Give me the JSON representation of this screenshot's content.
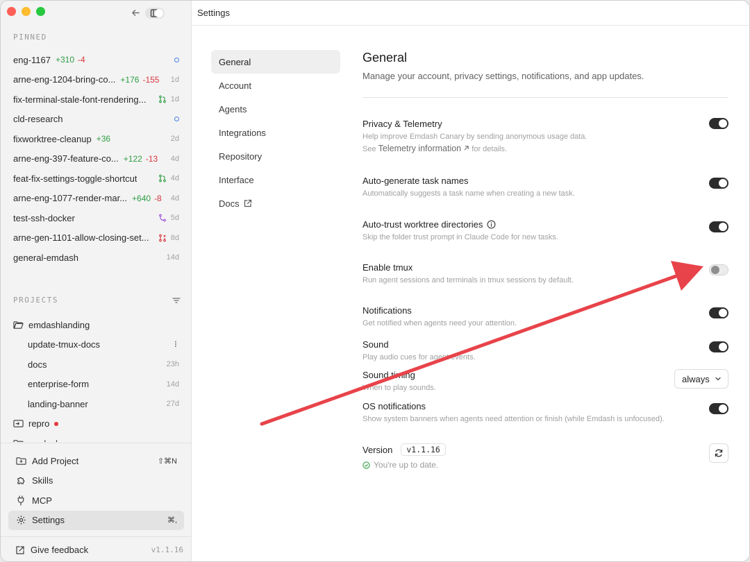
{
  "window": {
    "title": "Settings"
  },
  "sidebar": {
    "pinned_label": "PINNED",
    "pinned": [
      {
        "name": "eng-1167",
        "add": "+310",
        "del": "-4",
        "indicator": "dot",
        "age": ""
      },
      {
        "name": "arne-eng-1204-bring-co...",
        "add": "+176",
        "del": "-155",
        "indicator": "",
        "age": "1d"
      },
      {
        "name": "fix-terminal-stale-font-rendering...",
        "add": "",
        "del": "",
        "indicator": "pr-green",
        "age": "1d"
      },
      {
        "name": "cld-research",
        "add": "",
        "del": "",
        "indicator": "dot",
        "age": ""
      },
      {
        "name": "fixworktree-cleanup",
        "add": "+36",
        "del": "",
        "indicator": "",
        "age": "2d"
      },
      {
        "name": "arne-eng-397-feature-co...",
        "add": "+122",
        "del": "-13",
        "indicator": "",
        "age": "4d"
      },
      {
        "name": "feat-fix-settings-toggle-shortcut",
        "add": "",
        "del": "",
        "indicator": "pr-green",
        "age": "4d"
      },
      {
        "name": "arne-eng-1077-render-mar...",
        "add": "+640",
        "del": "-8",
        "indicator": "",
        "age": "4d"
      },
      {
        "name": "test-ssh-docker",
        "add": "",
        "del": "",
        "indicator": "branch-purple",
        "age": "5d"
      },
      {
        "name": "arne-gen-1101-allow-closing-set...",
        "add": "",
        "del": "",
        "indicator": "pr-red",
        "age": "8d"
      },
      {
        "name": "general-emdash",
        "add": "",
        "del": "",
        "indicator": "",
        "age": "14d"
      }
    ],
    "projects_label": "PROJECTS",
    "projects": {
      "emdashlanding": "emdashlanding",
      "sub_items": [
        {
          "name": "update-tmux-docs",
          "age": ""
        },
        {
          "name": "docs",
          "age": "23h"
        },
        {
          "name": "enterprise-form",
          "age": "14d"
        },
        {
          "name": "landing-banner",
          "age": "27d"
        }
      ],
      "repro": "repro",
      "emdash": "emdash"
    },
    "bottom": {
      "add_project": "Add Project",
      "add_project_kbd": "⇧⌘N",
      "skills": "Skills",
      "mcp": "MCP",
      "settings": "Settings",
      "settings_kbd": "⌘,"
    },
    "feedback": "Give feedback",
    "version": "v1.1.16"
  },
  "subnav": {
    "general": "General",
    "account": "Account",
    "agents": "Agents",
    "integrations": "Integrations",
    "repository": "Repository",
    "interface": "Interface",
    "docs": "Docs"
  },
  "general": {
    "title": "General",
    "description": "Manage your account, privacy settings, notifications, and app updates.",
    "privacy": {
      "title": "Privacy & Telemetry",
      "desc": "Help improve Emdash Canary by sending anonymous usage data.",
      "see": "See",
      "link": "Telemetry information",
      "for_details": "for details.",
      "on": true
    },
    "autogen": {
      "title": "Auto-generate task names",
      "desc": "Automatically suggests a task name when creating a new task.",
      "on": true
    },
    "autotrust": {
      "title": "Auto-trust worktree directories",
      "desc": "Skip the folder trust prompt in Claude Code for new tasks.",
      "on": true
    },
    "tmux": {
      "title": "Enable tmux",
      "desc": "Run agent sessions and terminals in tmux sessions by default.",
      "on": false
    },
    "notifications": {
      "title": "Notifications",
      "desc": "Get notified when agents need your attention.",
      "on": true
    },
    "sound": {
      "title": "Sound",
      "desc": "Play audio cues for agent events.",
      "on": true
    },
    "sound_timing": {
      "title": "Sound timing",
      "desc": "When to play sounds.",
      "value": "always"
    },
    "os_notifications": {
      "title": "OS notifications",
      "desc": "Show system banners when agents need attention or finish (while Emdash is unfocused).",
      "on": true
    },
    "version": {
      "label": "Version",
      "value": "v1.1.16",
      "status": "You're up to date."
    }
  },
  "colors": {
    "accent_add": "#2e9e44",
    "accent_del": "#d9363e",
    "toggle_on": "#2c2c2c",
    "annotation_arrow": "#e8434a"
  }
}
